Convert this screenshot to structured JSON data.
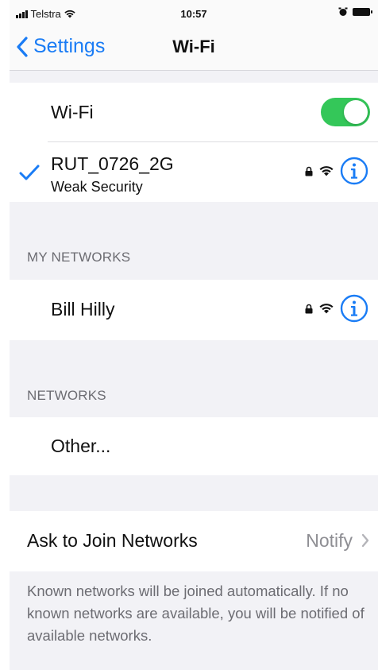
{
  "status_bar": {
    "carrier": "Telstra",
    "time": "10:57",
    "icons": [
      "signal-bars-icon",
      "wifi-icon",
      "alarm-icon",
      "battery-icon"
    ]
  },
  "nav": {
    "back_label": "Settings",
    "title": "Wi-Fi"
  },
  "wifi_toggle": {
    "label": "Wi-Fi",
    "state": "on",
    "color": "#34c759"
  },
  "connected_network": {
    "name": "RUT_0726_2G",
    "subtitle": "Weak Security",
    "icons": [
      "checkmark-icon",
      "lock-icon",
      "wifi-icon",
      "info-icon"
    ]
  },
  "my_networks": {
    "header": "MY NETWORKS",
    "items": [
      {
        "name": "Bill Hilly",
        "icons": [
          "lock-icon",
          "wifi-icon",
          "info-icon"
        ]
      }
    ]
  },
  "networks": {
    "header": "NETWORKS",
    "items": [
      {
        "name": "Other..."
      }
    ]
  },
  "ask_to_join": {
    "label": "Ask to Join Networks",
    "value": "Notify"
  },
  "footer": "Known networks will be joined automatically. If no known networks are available, you will be notified of available networks.",
  "colors": {
    "accent": "#1a7cf5",
    "toggle_on": "#34c759",
    "background": "#f2f2f6",
    "secondary_text": "#6c6c72"
  }
}
